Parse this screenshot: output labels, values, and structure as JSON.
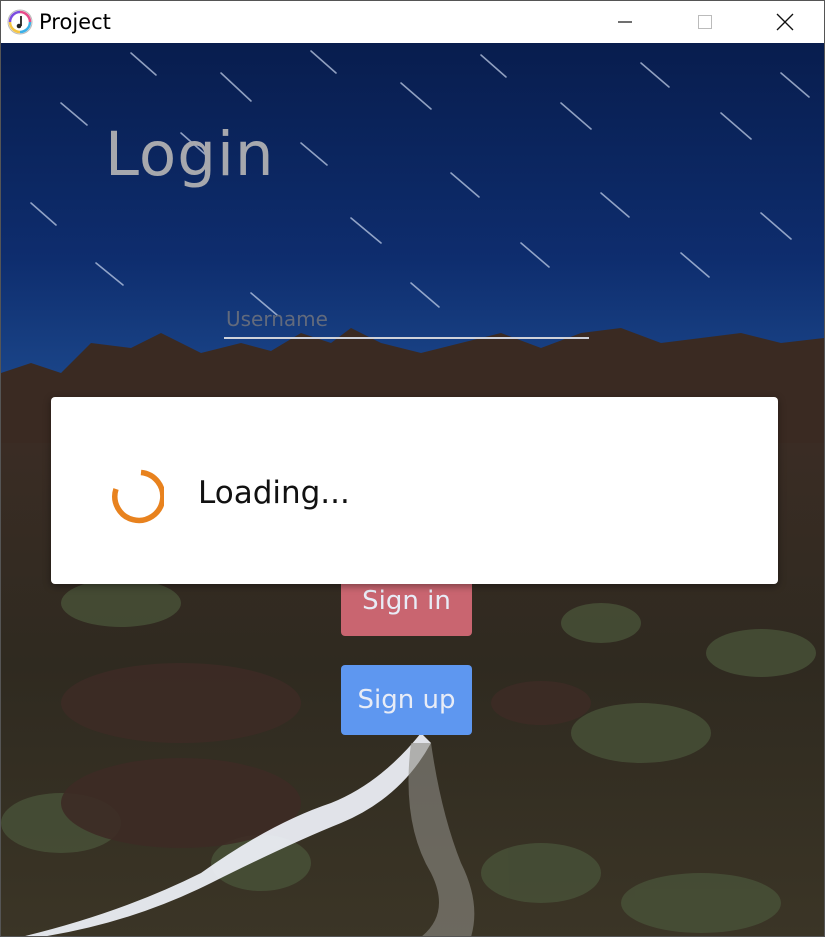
{
  "window": {
    "title": "Project"
  },
  "login": {
    "heading": "Login",
    "username_placeholder": "Username",
    "signin_label": "Sign in",
    "signup_label": "Sign up"
  },
  "dialog": {
    "message": "Loading..."
  },
  "colors": {
    "signin_button": "#c96570",
    "signup_button": "#5e97f0",
    "spinner": "#e8821e",
    "sky": "#0a2458"
  }
}
